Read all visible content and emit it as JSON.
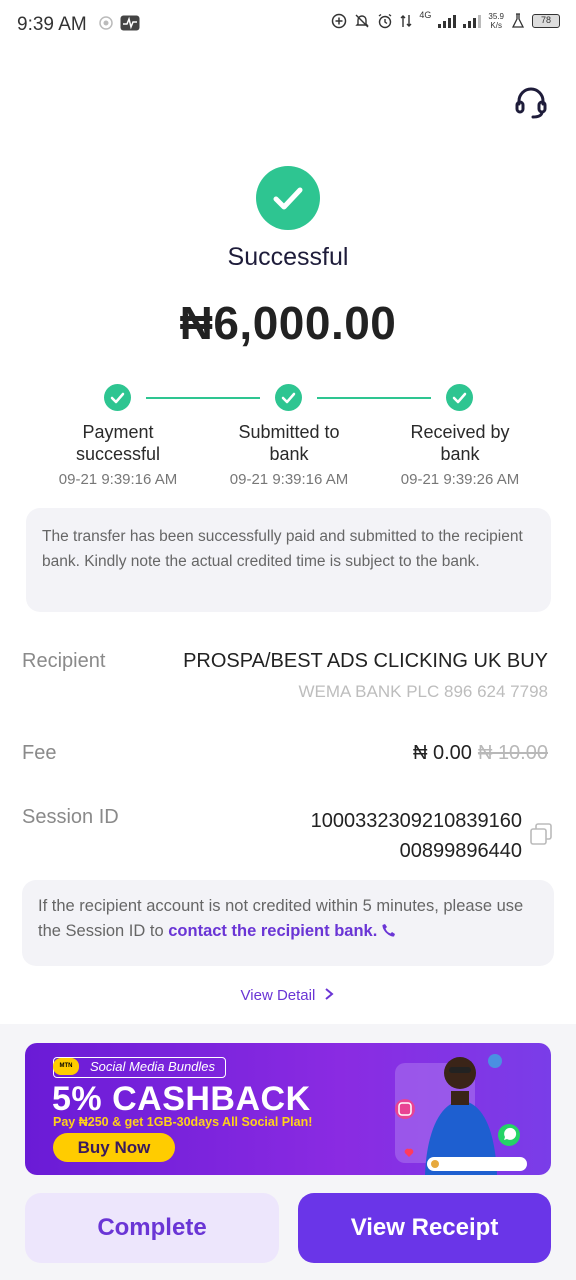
{
  "status_bar": {
    "time": "9:39 AM",
    "network": "4G",
    "speed": "35.9",
    "speed_unit": "K/s",
    "battery": "78"
  },
  "header": {
    "support_icon": "headset-icon"
  },
  "result": {
    "status_icon": "check-circle-icon",
    "title": "Successful",
    "amount": "₦6,000.00"
  },
  "progress": {
    "steps": [
      {
        "label": "Payment successful",
        "time": "09-21 9:39:16 AM",
        "done": true
      },
      {
        "label": "Submitted to bank",
        "time": "09-21 9:39:16 AM",
        "done": true
      },
      {
        "label": "Received by bank",
        "time": "09-21 9:39:26 AM",
        "done": true
      }
    ],
    "color": "#2ec591"
  },
  "info_message": "The transfer has been successfully paid and submitted to the recipient bank. Kindly note the actual credited time is subject to the bank.",
  "details": {
    "recipient_label": "Recipient",
    "recipient_name": "PROSPA/BEST ADS CLICKING UK BUY",
    "recipient_bank": "WEMA BANK PLC 896 624 7798",
    "fee_label": "Fee",
    "fee_value": "₦ 0.00",
    "fee_original": "₦ 10.00",
    "session_label": "Session ID",
    "session_id": "100033230921083916000899896440",
    "copy_icon": "copy-icon"
  },
  "note": {
    "text": "If the recipient account is not credited within 5 minutes, please use the Session ID to ",
    "link": "contact the recipient bank.",
    "link_icon": "phone-icon"
  },
  "view_detail": "View Detail",
  "banner": {
    "tag": "Social Media Bundles",
    "logo": "MTN",
    "headline": "5% CASHBACK",
    "subtitle": "Pay ₦250 & get 1GB-30days All Social Plan!",
    "button": "Buy Now"
  },
  "actions": {
    "complete": "Complete",
    "view_receipt": "View Receipt"
  },
  "colors": {
    "accent": "#6a35e8",
    "success": "#2ec591"
  }
}
